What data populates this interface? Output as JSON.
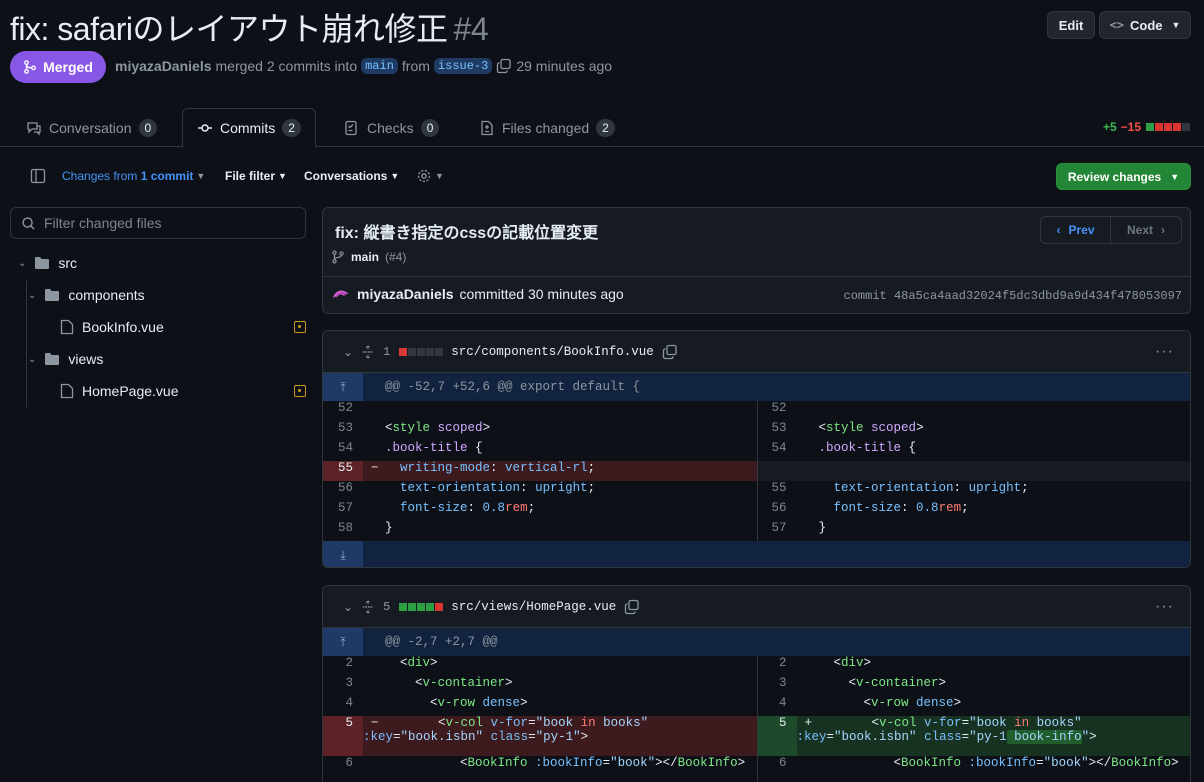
{
  "pr": {
    "title": "fix: safariのレイアウト崩れ修正",
    "number": "#4",
    "status": "Merged",
    "author": "miyazaDaniels",
    "merged_text": "merged 2 commits into",
    "base_branch": "main",
    "from_text": "from",
    "head_branch": "issue-3",
    "time": "29 minutes ago",
    "edit_label": "Edit",
    "code_label": "Code"
  },
  "tabs": [
    {
      "label": "Conversation",
      "count": "0"
    },
    {
      "label": "Commits",
      "count": "2"
    },
    {
      "label": "Checks",
      "count": "0"
    },
    {
      "label": "Files changed",
      "count": "2"
    }
  ],
  "diffstat": {
    "added": "+5",
    "removed": "−15"
  },
  "toolbar": {
    "changes_from": "Changes from",
    "commit_count": "1 commit",
    "file_filter": "File filter",
    "conversations": "Conversations",
    "review_changes": "Review changes"
  },
  "sidebar": {
    "filter_placeholder": "Filter changed files",
    "tree": [
      {
        "label": "src",
        "type": "folder"
      },
      {
        "label": "components",
        "type": "folder"
      },
      {
        "label": "BookInfo.vue",
        "type": "file"
      },
      {
        "label": "views",
        "type": "folder"
      },
      {
        "label": "HomePage.vue",
        "type": "file"
      }
    ]
  },
  "commit": {
    "message": "fix: 縦書き指定のcssの記載位置変更",
    "branch": "main",
    "pr_ref": "(#4)",
    "author": "miyazaDaniels",
    "action": "committed 30 minutes ago",
    "sha_label": "commit",
    "sha": "48a5ca4aad32024f5dc3dbd9a9d434f478053097",
    "prev_label": "Prev",
    "next_label": "Next"
  },
  "files": [
    {
      "changes": "1",
      "path": "src/components/BookInfo.vue",
      "hunk": "@@ -52,7 +52,6 @@ export default {"
    },
    {
      "changes": "5",
      "path": "src/views/HomePage.vue",
      "hunk": "@@ -2,7 +2,7 @@"
    }
  ],
  "colors": {
    "merged": "#8957e5",
    "review": "#238636",
    "added": "#3fb950",
    "removed": "#f85149"
  }
}
